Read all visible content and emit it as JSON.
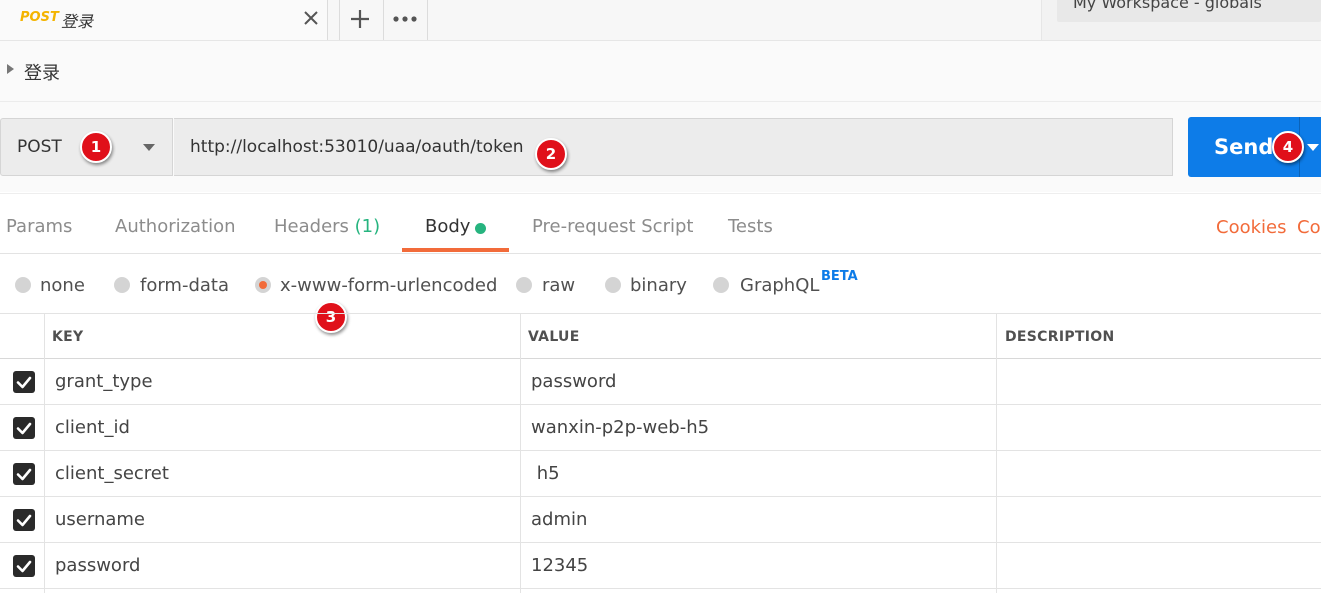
{
  "tab": {
    "method": "POST",
    "title": "登录"
  },
  "environment": {
    "label": "My Workspace - globals"
  },
  "breadcrumb": {
    "label": "登录"
  },
  "request": {
    "method": "POST",
    "url": "http://localhost:53010/uaa/oauth/token",
    "send_label": "Send"
  },
  "badges": [
    "1",
    "2",
    "3",
    "4"
  ],
  "subtabs": {
    "params": "Params",
    "authorization": "Authorization",
    "headers": "Headers",
    "headers_count": "(1)",
    "body": "Body",
    "prerequest": "Pre-request Script",
    "tests": "Tests",
    "cookies": "Cookies",
    "code": "Co"
  },
  "body_types": {
    "none": "none",
    "form_data": "form-data",
    "urlencoded": "x-www-form-urlencoded",
    "raw": "raw",
    "binary": "binary",
    "graphql": "GraphQL",
    "beta": "BETA",
    "selected": "x-www-form-urlencoded"
  },
  "table": {
    "headers": {
      "key": "KEY",
      "value": "VALUE",
      "description": "DESCRIPTION"
    },
    "rows": [
      {
        "checked": true,
        "key": "grant_type",
        "value": "password",
        "description": ""
      },
      {
        "checked": true,
        "key": "client_id",
        "value": "wanxin-p2p-web-h5",
        "description": ""
      },
      {
        "checked": true,
        "key": "client_secret",
        "value": " h5",
        "description": ""
      },
      {
        "checked": true,
        "key": "username",
        "value": "admin",
        "description": ""
      },
      {
        "checked": true,
        "key": "password",
        "value": "12345",
        "description": ""
      }
    ]
  },
  "colors": {
    "accent": "#f26b3a",
    "send": "#0d7ce8",
    "badge": "#e0101a",
    "success": "#26b47f"
  }
}
